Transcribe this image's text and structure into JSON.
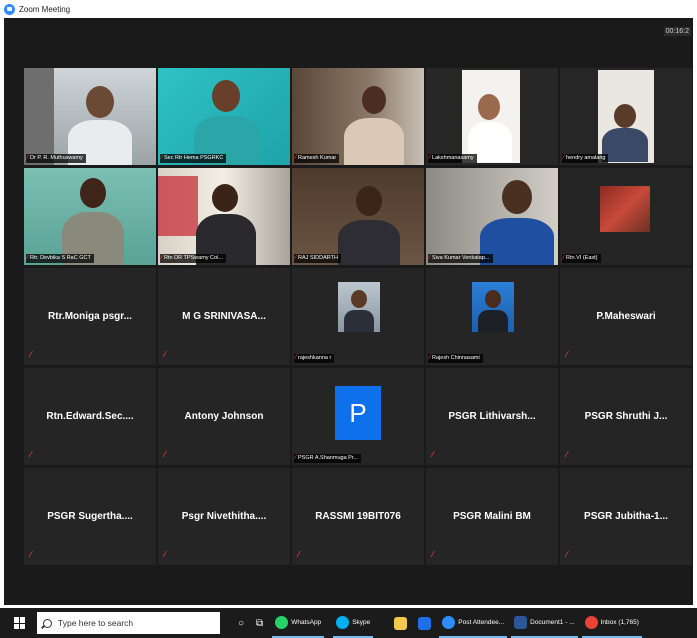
{
  "window": {
    "title": "Zoom Meeting"
  },
  "meeting": {
    "timer": "00:16:2",
    "tiles": [
      {
        "kind": "video",
        "label": "Dr P. R. Muthuswamy",
        "active": true
      },
      {
        "kind": "video",
        "label": "Sec Rtr Hema PSGRKC"
      },
      {
        "kind": "video",
        "label": "Ramesh Kumar"
      },
      {
        "kind": "video",
        "label": "Lakshmanasamy"
      },
      {
        "kind": "video",
        "label": "hendry amalang"
      },
      {
        "kind": "video",
        "label": "Rtr. Devbika S RaC GCT"
      },
      {
        "kind": "video",
        "label": "Rtn DR TPSwamy Col..."
      },
      {
        "kind": "video",
        "label": "RAJ SIDDARTH"
      },
      {
        "kind": "video",
        "label": "Siva Kumar Venkatap..."
      },
      {
        "kind": "video",
        "label": "Rtn.VI (East)"
      },
      {
        "kind": "name",
        "name": "Rtr.Moniga psgr..."
      },
      {
        "kind": "name",
        "name": "M G SRINIVASA..."
      },
      {
        "kind": "photo",
        "label": "rajeshkanna r"
      },
      {
        "kind": "photo",
        "label": "Rajesh Chinnasami"
      },
      {
        "kind": "name",
        "name": "P.Maheswari"
      },
      {
        "kind": "name",
        "name": "Rtn.Edward.Sec...."
      },
      {
        "kind": "name",
        "name": "Antony Johnson"
      },
      {
        "kind": "initial",
        "initial": "P",
        "label": "PSGR A.Shanmuga Pr..."
      },
      {
        "kind": "name",
        "name": "PSGR  Lithivarsh..."
      },
      {
        "kind": "name",
        "name": "PSGR  Shruthi  J..."
      },
      {
        "kind": "name",
        "name": "PSGR  Sugertha...."
      },
      {
        "kind": "name",
        "name": "Psgr  Nivethitha...."
      },
      {
        "kind": "name",
        "name": "RASSMI 19BIT076"
      },
      {
        "kind": "name",
        "name": "PSGR Malini BM"
      },
      {
        "kind": "name",
        "name": "PSGR  Jubitha-1..."
      }
    ]
  },
  "taskbar": {
    "search_placeholder": "Type here to search",
    "apps": [
      {
        "label": "WhatsApp",
        "color": "#25d366"
      },
      {
        "label": "Skype",
        "color": "#00aff0"
      },
      {
        "label": "",
        "color": "#f2c94c"
      },
      {
        "label": "",
        "color": "#1f6feb"
      },
      {
        "label": "Post Attendee...",
        "color": "#2d8cff"
      },
      {
        "label": "Document1 - ...",
        "color": "#2b579a"
      },
      {
        "label": "Inbox (1,765)",
        "color": "#ea4335"
      }
    ]
  }
}
